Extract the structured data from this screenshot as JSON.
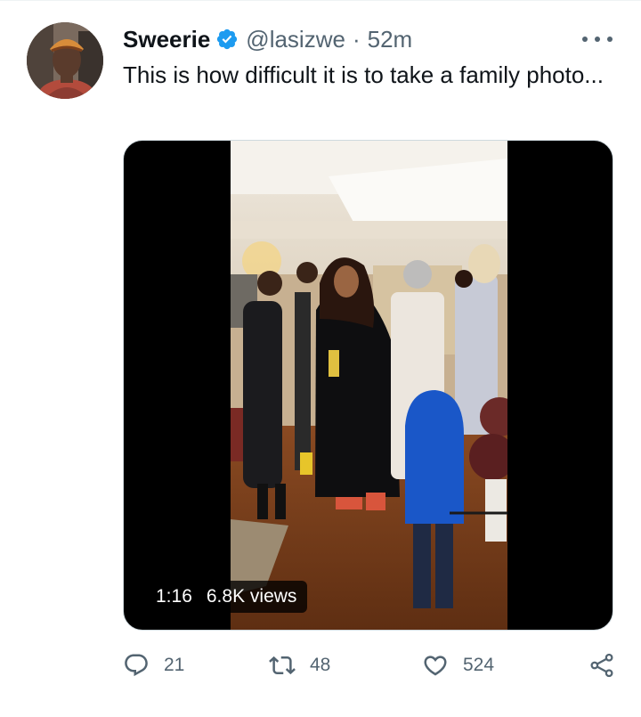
{
  "tweet": {
    "author_name": "Sweerie",
    "handle": "@lasizwe",
    "separator": "·",
    "time": "52m",
    "text": "This is how difficult it is to take a family photo...",
    "video": {
      "duration": "1:16",
      "views": "6.8K views"
    },
    "actions": {
      "replies": "21",
      "retweets": "48",
      "likes": "524"
    }
  },
  "icons": {
    "verified": "verified-badge-icon",
    "more": "more-options-icon",
    "reply": "reply-icon",
    "retweet": "retweet-icon",
    "like": "heart-icon",
    "share": "share-icon"
  },
  "colors": {
    "verified_blue": "#1d9bf0",
    "secondary_text": "#536471",
    "primary_text": "#0f1419"
  }
}
